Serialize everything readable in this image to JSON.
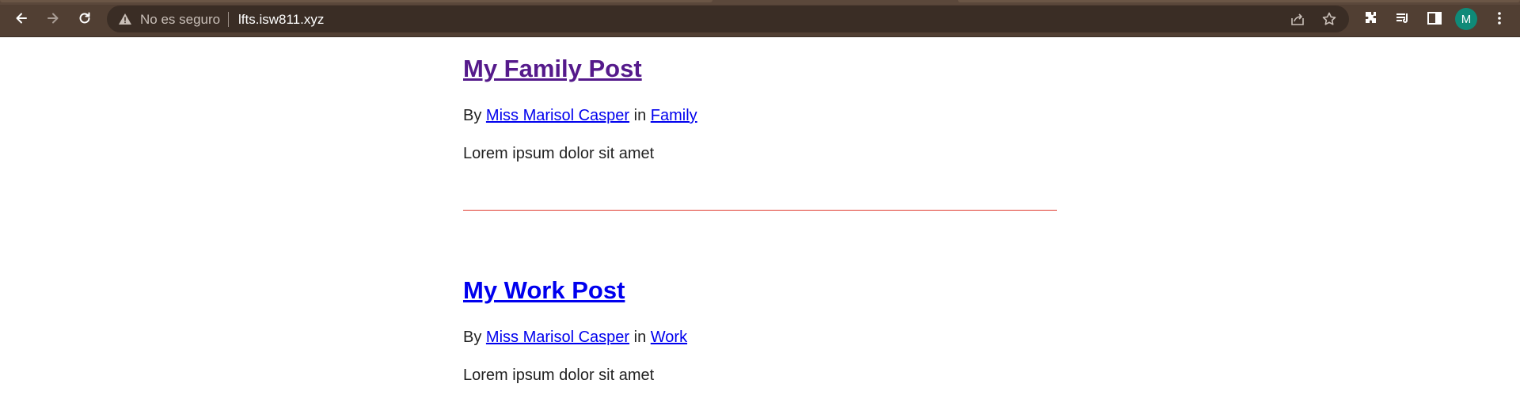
{
  "browser": {
    "security_label": "No es seguro",
    "url": "lfts.isw811.xyz",
    "avatar_initial": "M",
    "accent_avatar": "#0f8a78",
    "toolbar_color": "#513f33",
    "icons": [
      "back-icon",
      "forward-icon",
      "reload-icon",
      "warning-icon",
      "share-icon",
      "star-icon",
      "extensions-icon",
      "reading-list-icon",
      "side-panel-icon",
      "kebab-menu-icon"
    ]
  },
  "posts": [
    {
      "title": "My Family Post",
      "by_label": "By",
      "author": "Miss Marisol Casper",
      "in_label": "in",
      "category": "Family",
      "excerpt": "Lorem ipsum dolor sit amet"
    },
    {
      "title": "My Work Post",
      "by_label": "By",
      "author": "Miss Marisol Casper",
      "in_label": "in",
      "category": "Work",
      "excerpt": "Lorem ipsum dolor sit amet"
    }
  ],
  "colors": {
    "visited_link": "#551a8b",
    "link": "#0000ee",
    "divider": "#e03a2f"
  }
}
